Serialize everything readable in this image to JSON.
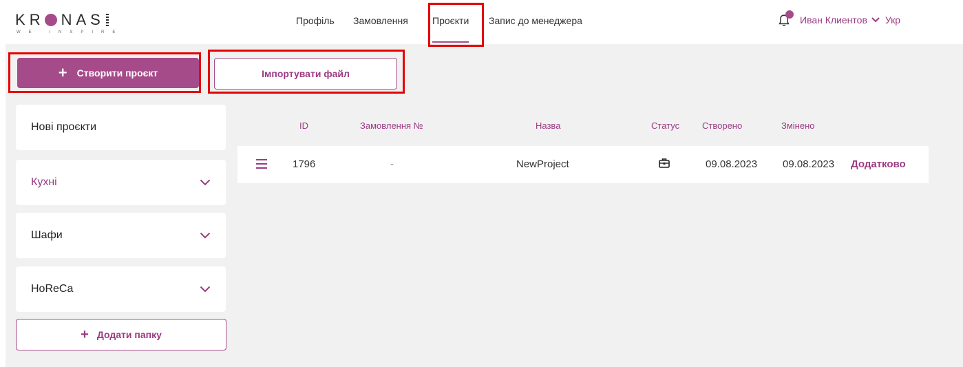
{
  "brand": {
    "name": "KRONAS",
    "tagline": "WE INSPIRE"
  },
  "nav": {
    "items": [
      "Профіль",
      "Замовлення",
      "Проєкти",
      "Запис до менеджера"
    ],
    "active": "Проєкти"
  },
  "user": {
    "name": "Иван Клиентов",
    "language": "Укр"
  },
  "actions": {
    "create_project": "Створити проєкт",
    "import_file": "Імпортувати файл",
    "add_folder": "Додати папку"
  },
  "sidebar": {
    "items": [
      {
        "label": "Нові проєкти"
      },
      {
        "label": "Кухні"
      },
      {
        "label": "Шафи"
      },
      {
        "label": "HoReCa"
      }
    ]
  },
  "table": {
    "headers": {
      "id": "ID",
      "order": "Замовлення №",
      "name": "Назва",
      "status": "Статус",
      "created": "Створено",
      "modified": "Змінено"
    },
    "rows": [
      {
        "id": "1796",
        "order": "-",
        "name": "NewProject",
        "status_icon": "briefcase-icon",
        "created": "09.08.2023",
        "modified": "09.08.2023",
        "more": "Додатково"
      }
    ]
  },
  "colors": {
    "accent": "#a64b8a",
    "highlight": "#e50000",
    "background": "#f1f1f1"
  }
}
